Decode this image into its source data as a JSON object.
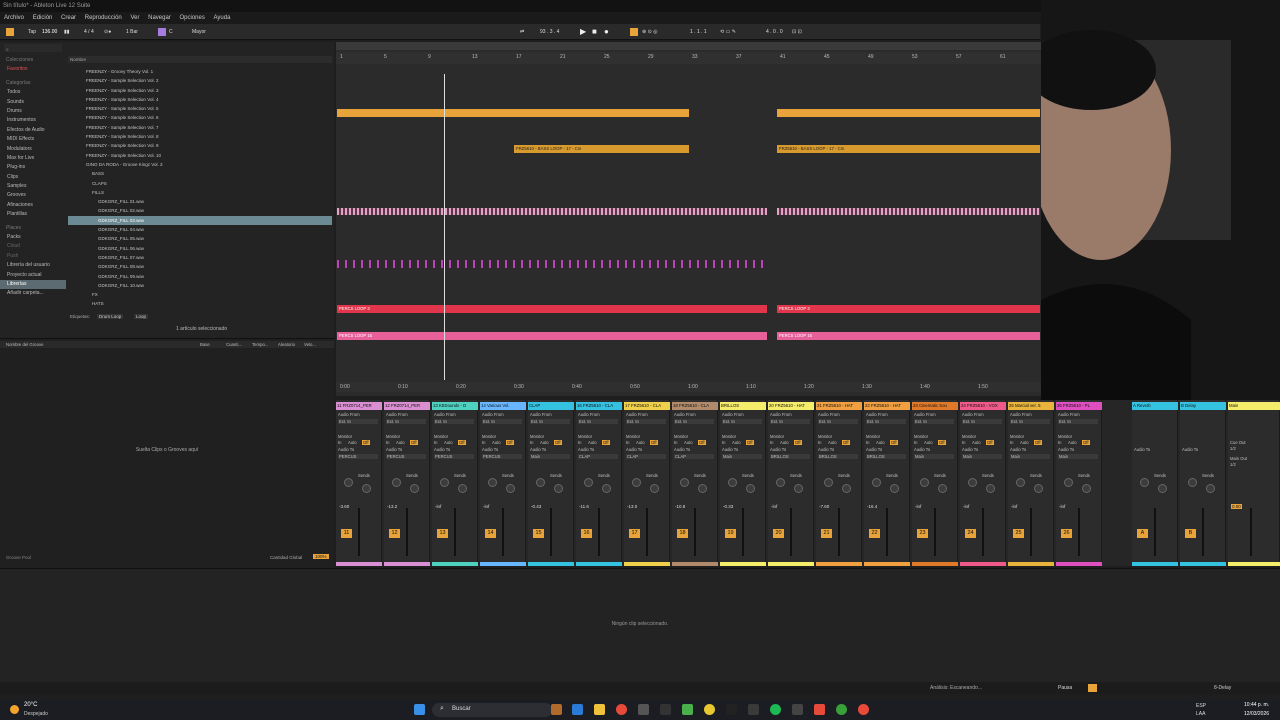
{
  "window": {
    "title": "Sin título* - Ableton Live 12 Suite"
  },
  "menu": [
    "Archivo",
    "Edición",
    "Crear",
    "Reproducción",
    "Ver",
    "Navegar",
    "Opciones",
    "Ayuda"
  ],
  "control_bar": {
    "tap": "Tap",
    "tempo": "136.00",
    "signature": "4 / 4",
    "quantize": "1 Bar",
    "key": "C",
    "scale": "Mayor",
    "position": "1 . 1 . 1",
    "loop_end": "4 . 0 . 0",
    "arr_pos": "93 . 3 . 4"
  },
  "browser": {
    "sections": {
      "collections": "Colecciones",
      "categories": "Categorías",
      "places": "Places"
    },
    "left_items": [
      {
        "label": "Favoritos",
        "color": "#e05050"
      },
      {
        "label": "Todos"
      },
      {
        "label": "Sounds"
      },
      {
        "label": "Drums"
      },
      {
        "label": "Instrumentos"
      },
      {
        "label": "Efectos de Audio"
      },
      {
        "label": "MIDI Effects"
      },
      {
        "label": "Modulators"
      },
      {
        "label": "Max for Live"
      },
      {
        "label": "Plug-ins"
      },
      {
        "label": "Clips"
      },
      {
        "label": "Samples"
      },
      {
        "label": "Grooves"
      },
      {
        "label": "Afinaciones"
      },
      {
        "label": "Plantillas"
      },
      {
        "label": "Places"
      },
      {
        "label": "Packs"
      },
      {
        "label": "Cloud"
      },
      {
        "label": "Push"
      },
      {
        "label": "Librería del usuario"
      },
      {
        "label": "Proyecto actual"
      },
      {
        "label": "Librerías",
        "selected": true
      },
      {
        "label": "Añadir carpeta..."
      }
    ],
    "column_header": "Nombre",
    "right_items": [
      {
        "label": "FREENZY - Groovy Theory Vol. 1"
      },
      {
        "label": "FREENZY - Sample Selection Vol. 2"
      },
      {
        "label": "FREENZY - Sample Selection Vol. 3"
      },
      {
        "label": "FREENZY - Sample Selection Vol. 4"
      },
      {
        "label": "FREENZY - Sample Selection Vol. 5"
      },
      {
        "label": "FREENZY - Sample Selection Vol. 6"
      },
      {
        "label": "FREENZY - Sample Selection Vol. 7"
      },
      {
        "label": "FREENZY - Sample Selection Vol. 8"
      },
      {
        "label": "FREENZY - Sample Selection Vol. 9"
      },
      {
        "label": "FREENZY - Sample Selection Vol. 10"
      },
      {
        "label": "GINO DA RODA - Groove Kingz Vol. 3"
      },
      {
        "label": "BASS",
        "indent": 2
      },
      {
        "label": "CLAPS",
        "indent": 2
      },
      {
        "label": "FILLS",
        "indent": 2
      },
      {
        "label": "GDKGRZ_FILL 01.wav",
        "indent": 3
      },
      {
        "label": "GDKGRZ_FILL 02.wav",
        "indent": 3
      },
      {
        "label": "GDKGRZ_FILL 03.wav",
        "indent": 3,
        "selected": true
      },
      {
        "label": "GDKGRZ_FILL 04.wav",
        "indent": 3
      },
      {
        "label": "GDKGRZ_FILL 05.wav",
        "indent": 3
      },
      {
        "label": "GDKGRZ_FILL 06.wav",
        "indent": 3
      },
      {
        "label": "GDKGRZ_FILL 07.wav",
        "indent": 3
      },
      {
        "label": "GDKGRZ_FILL 08.wav",
        "indent": 3
      },
      {
        "label": "GDKGRZ_FILL 09.wav",
        "indent": 3
      },
      {
        "label": "GDKGRZ_FILL 10.wav",
        "indent": 3
      },
      {
        "label": "FX",
        "indent": 2
      },
      {
        "label": "HATS",
        "indent": 2
      }
    ],
    "tags_label": "Etiquetas:",
    "tag_chips": [
      "Drum Loop",
      "Loop"
    ],
    "selected_count": "1 artículo seleccionado"
  },
  "groove_pool": {
    "columns": [
      "Nombre del Groove",
      "Base",
      "Cuanti...",
      "Tempo...",
      "Aleatorio",
      "Velo..."
    ],
    "empty_text": "Suelta Clips o Grooves aquí",
    "footer_left": "Groove Pool",
    "global_amount_label": "Cantidad Global",
    "global_amount": "100%"
  },
  "arrangement": {
    "ruler_numbers": [
      "1",
      "5",
      "9",
      "13",
      "17",
      "21",
      "25",
      "29",
      "33",
      "37",
      "41",
      "45",
      "49",
      "53",
      "57",
      "61"
    ],
    "time_numbers": [
      "0:00",
      "0:10",
      "0:20",
      "0:30",
      "0:40",
      "0:50",
      "1:00",
      "1:10",
      "1:20",
      "1:30",
      "1:40",
      "1:50"
    ],
    "clip_labels": {
      "bass_a": "FRZ5610 - BASS LOOP - 17 - Cm",
      "bass_b": "FRZ5610 - BASS LOOP - 17 - Cm",
      "perc": "PERCS LOOP 3",
      "perc2": "PERCS LOOP 16"
    }
  },
  "mixer": {
    "tracks": [
      {
        "name": "11 FRZ0714_PER",
        "color": "#d98fd1",
        "input": "PERCUS",
        "vol": "-3.60",
        "num": "11"
      },
      {
        "name": "12 FRZ0714_PER",
        "color": "#d98fd1",
        "input": "PERCUS",
        "vol": "-13.2",
        "num": "12"
      },
      {
        "name": "13 KBSounds - D",
        "color": "#4fd1c0",
        "input": "PERCUS",
        "vol": "-inf",
        "num": "13"
      },
      {
        "name": "14 Various Vol.",
        "color": "#67b6ff",
        "input": "PERCUS",
        "vol": "-inf",
        "num": "14"
      },
      {
        "name": "CLAP",
        "color": "#34c2e0",
        "input": "Main",
        "vol": "-0.43",
        "num": "15"
      },
      {
        "name": "16 FRZ5610 - CLA",
        "color": "#34c2e0",
        "input": "CLAP",
        "vol": "-11.6",
        "num": "16"
      },
      {
        "name": "17 FRZ5610 - CLA",
        "color": "#f0d04a",
        "input": "CLAP",
        "vol": "-13.0",
        "num": "17"
      },
      {
        "name": "18 FRZ5610 - CLA",
        "color": "#b08a6a",
        "input": "CLAP",
        "vol": "-10.8",
        "num": "18"
      },
      {
        "name": "BRILLOS",
        "color": "#f5ee6a",
        "input": "Main",
        "vol": "-0.33",
        "num": "19"
      },
      {
        "name": "20 FRZ5610 - HAT",
        "color": "#f5ee6a",
        "input": "BRILLOS",
        "vol": "-inf",
        "num": "20"
      },
      {
        "name": "21 FRZ5610 - HAT",
        "color": "#f0a040",
        "input": "BRILLOS",
        "vol": "-7.60",
        "num": "21"
      },
      {
        "name": "22 FRZ5610 - HAT",
        "color": "#f0a040",
        "input": "BRILLOS",
        "vol": "-16.4",
        "num": "22"
      },
      {
        "name": "23 Cinematic Sou",
        "color": "#e07a2a",
        "input": "Main",
        "vol": "-inf",
        "num": "23"
      },
      {
        "name": "24 FRZ5610 - VOX",
        "color": "#ef5a8a",
        "input": "Main",
        "vol": "-inf",
        "num": "24"
      },
      {
        "name": "25 Marcial ver. 5",
        "color": "#e8b43c",
        "input": "Main",
        "vol": "-inf",
        "num": "25"
      },
      {
        "name": "26 FRZ5610 - PL",
        "color": "#e04fc0",
        "input": "Main",
        "vol": "-inf",
        "num": "26"
      }
    ],
    "returns": [
      {
        "name": "A Reverb",
        "color": "#34c2e0",
        "num": "A"
      },
      {
        "name": "B Delay",
        "color": "#34c2e0",
        "num": "B"
      }
    ],
    "main": {
      "name": "Main",
      "color": "#f5ee6a",
      "cue_label": "Cue Out",
      "cue_value": "1/2",
      "main_out": "Main Out",
      "main_value": "1/2",
      "vol": "0.00"
    },
    "labels": {
      "audio_from": "Audio From",
      "ext_in": "Ext. In",
      "monitor": "Monitor",
      "in": "In",
      "auto": "Auto",
      "off": "Off",
      "audio_to": "Audio To",
      "sends": "Sends"
    }
  },
  "clip_view": {
    "empty_text": "Ningún clip seleccionado."
  },
  "status_bar": {
    "analysis": "Análisis: Escaneando...",
    "pause": "Pausa",
    "device": "8-Delay"
  },
  "taskbar": {
    "weather_temp": "20°C",
    "weather_desc": "Despejado",
    "search": "Buscar",
    "lang": "ESP",
    "lang2": "LAA",
    "time": "10:44 p. m.",
    "date": "12/03/2026"
  }
}
